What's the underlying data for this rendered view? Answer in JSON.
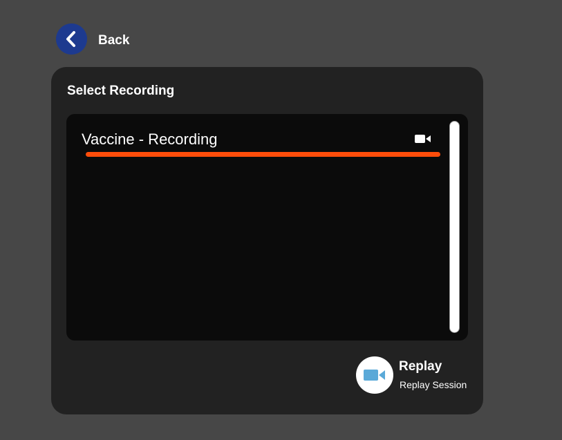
{
  "header": {
    "back_label": "Back",
    "back_icon": "chevron-left-icon",
    "back_button_color": "#1d3a8f"
  },
  "panel": {
    "title": "Select Recording",
    "recordings": [
      {
        "label": "Vaccine - Recording",
        "icon": "video-camera-icon",
        "selected": true,
        "underline_color": "#ff4d0a"
      }
    ]
  },
  "actions": {
    "replay_title": "Replay",
    "replay_subtitle": "Replay Session",
    "replay_icon": "video-camera-icon",
    "replay_icon_color": "#5aa9d8"
  }
}
